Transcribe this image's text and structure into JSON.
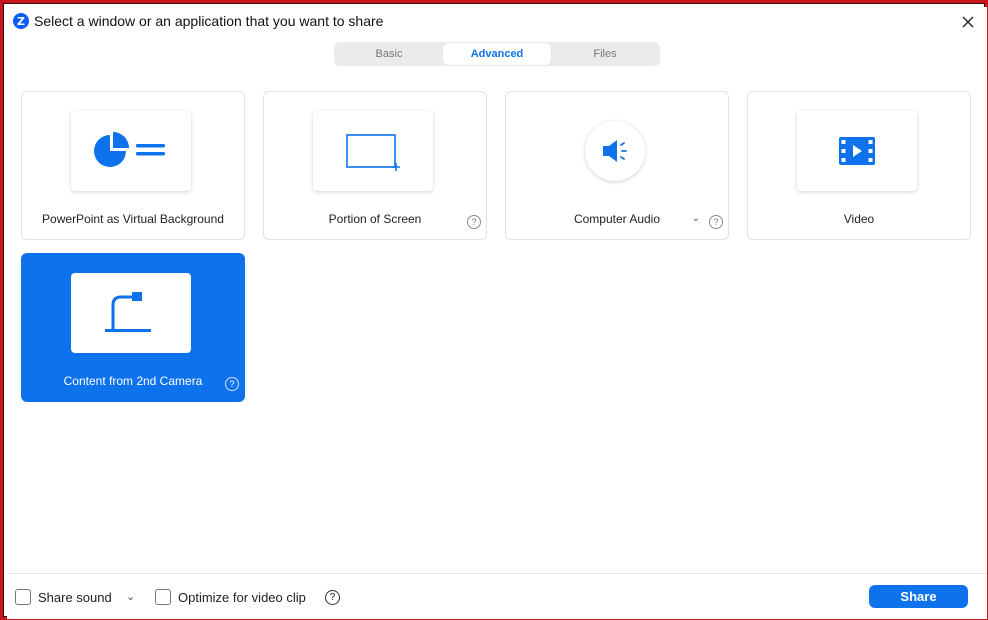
{
  "window": {
    "title": "Select a window or an application that you want to share",
    "logo_letter": "Z",
    "close_icon": "close-icon"
  },
  "tabs": [
    {
      "label": "Basic",
      "active": false
    },
    {
      "label": "Advanced",
      "active": true
    },
    {
      "label": "Files",
      "active": false
    }
  ],
  "options": [
    {
      "label": "PowerPoint as Virtual Background",
      "icon": "powerpoint-pie-icon",
      "help": false
    },
    {
      "label": "Portion of Screen",
      "icon": "screen-portion-icon",
      "help": true,
      "help_glyph": "?"
    },
    {
      "label": "Computer Audio",
      "icon": "speaker-icon",
      "help": true,
      "help_glyph": "?",
      "dropdown_glyph": "⌄"
    },
    {
      "label": "Video",
      "icon": "video-film-icon",
      "help": false
    },
    {
      "label": "Content from 2nd Camera",
      "icon": "document-camera-icon",
      "help": true,
      "help_glyph": "?",
      "selected": true
    }
  ],
  "footer": {
    "share_sound_label": "Share sound",
    "share_sound_checked": false,
    "share_sound_dropdown_glyph": "⌄",
    "optimize_label": "Optimize for video clip",
    "optimize_checked": false,
    "help_glyph": "?",
    "share_button_label": "Share"
  },
  "colors": {
    "accent": "#0e72ed",
    "frame_border": "#c8161e"
  }
}
